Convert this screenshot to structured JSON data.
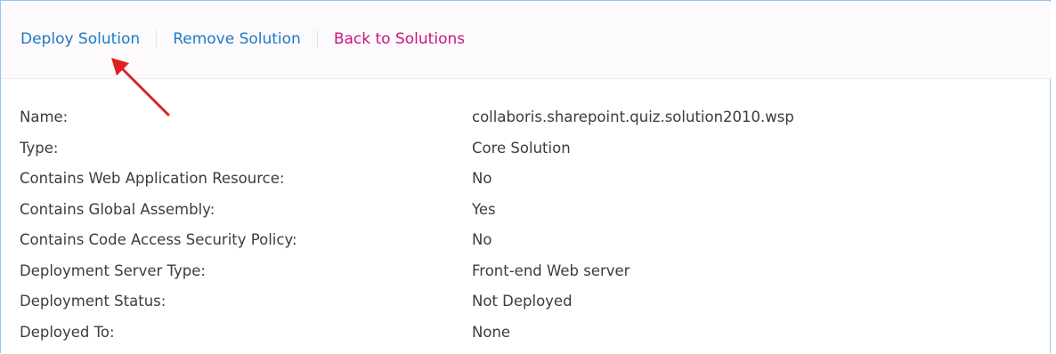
{
  "toolbar": {
    "deploy_label": "Deploy Solution",
    "remove_label": "Remove Solution",
    "back_label": "Back to Solutions"
  },
  "colors": {
    "link_blue": "#1f79c4",
    "link_magenta": "#c8177f",
    "annotation_arrow": "#e02020"
  },
  "properties": [
    {
      "label": "Name:",
      "value": "collaboris.sharepoint.quiz.solution2010.wsp"
    },
    {
      "label": "Type:",
      "value": "Core Solution"
    },
    {
      "label": "Contains Web Application Resource:",
      "value": "No"
    },
    {
      "label": "Contains Global Assembly:",
      "value": "Yes"
    },
    {
      "label": "Contains Code Access Security Policy:",
      "value": "No"
    },
    {
      "label": "Deployment Server Type:",
      "value": "Front-end Web server"
    },
    {
      "label": "Deployment Status:",
      "value": "Not Deployed"
    },
    {
      "label": "Deployed To:",
      "value": "None"
    }
  ]
}
